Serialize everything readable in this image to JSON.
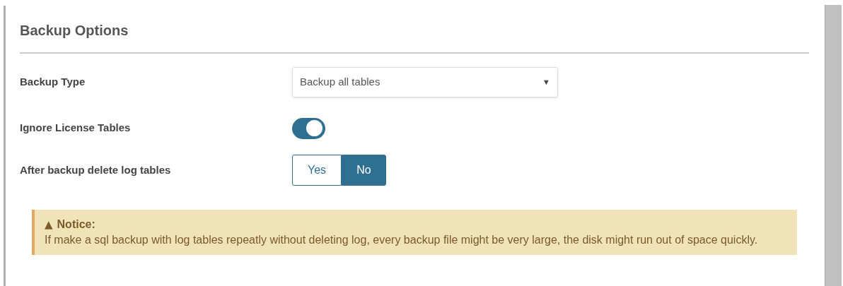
{
  "section": {
    "title": "Backup Options"
  },
  "fields": [
    {
      "kind": "select",
      "label": "Backup Type",
      "value": "Backup all tables",
      "caret": "▼"
    },
    {
      "kind": "toggle",
      "label": "Ignore License Tables",
      "on": true
    },
    {
      "kind": "segmented",
      "label": "After backup delete log tables",
      "options": [
        {
          "label": "Yes",
          "selected": false
        },
        {
          "label": "No",
          "selected": true
        }
      ]
    }
  ],
  "notice": {
    "icon": "▲",
    "title": "Notice:",
    "text": "If make a sql backup with log tables repeatly without deleting log, every backup file might be very large, the disk might run out of space quickly."
  }
}
